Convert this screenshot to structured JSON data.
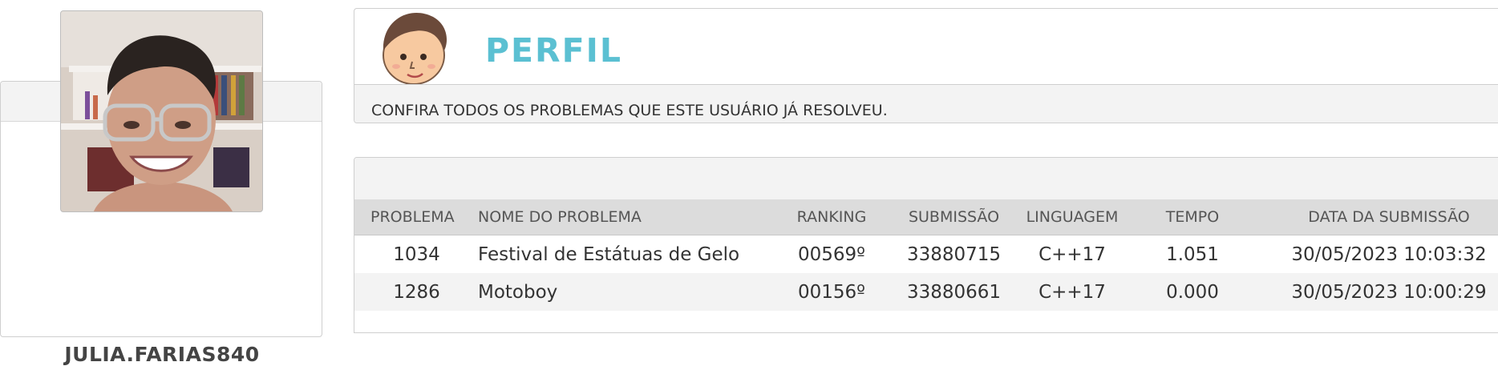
{
  "profile": {
    "username": "JULIA.FARIAS840",
    "avatar_icon": "user-photo"
  },
  "header": {
    "title": "PERFIL",
    "subtitle": "CONFIRA TODOS OS PROBLEMAS QUE ESTE USUÁRIO JÁ RESOLVEU.",
    "accent_color": "#5bc0d2"
  },
  "table": {
    "columns": [
      "PROBLEMA",
      "NOME DO PROBLEMA",
      "RANKING",
      "SUBMISSÃO",
      "LINGUAGEM",
      "TEMPO",
      "DATA DA SUBMISSÃO"
    ],
    "rows": [
      [
        "1034",
        "Festival de Estátuas de Gelo",
        "00569º",
        "33880715",
        "C++17",
        "1.051",
        "30/05/2023 10:03:32"
      ],
      [
        "1286",
        "Motoboy",
        "00156º",
        "33880661",
        "C++17",
        "0.000",
        "30/05/2023 10:00:29"
      ]
    ]
  }
}
